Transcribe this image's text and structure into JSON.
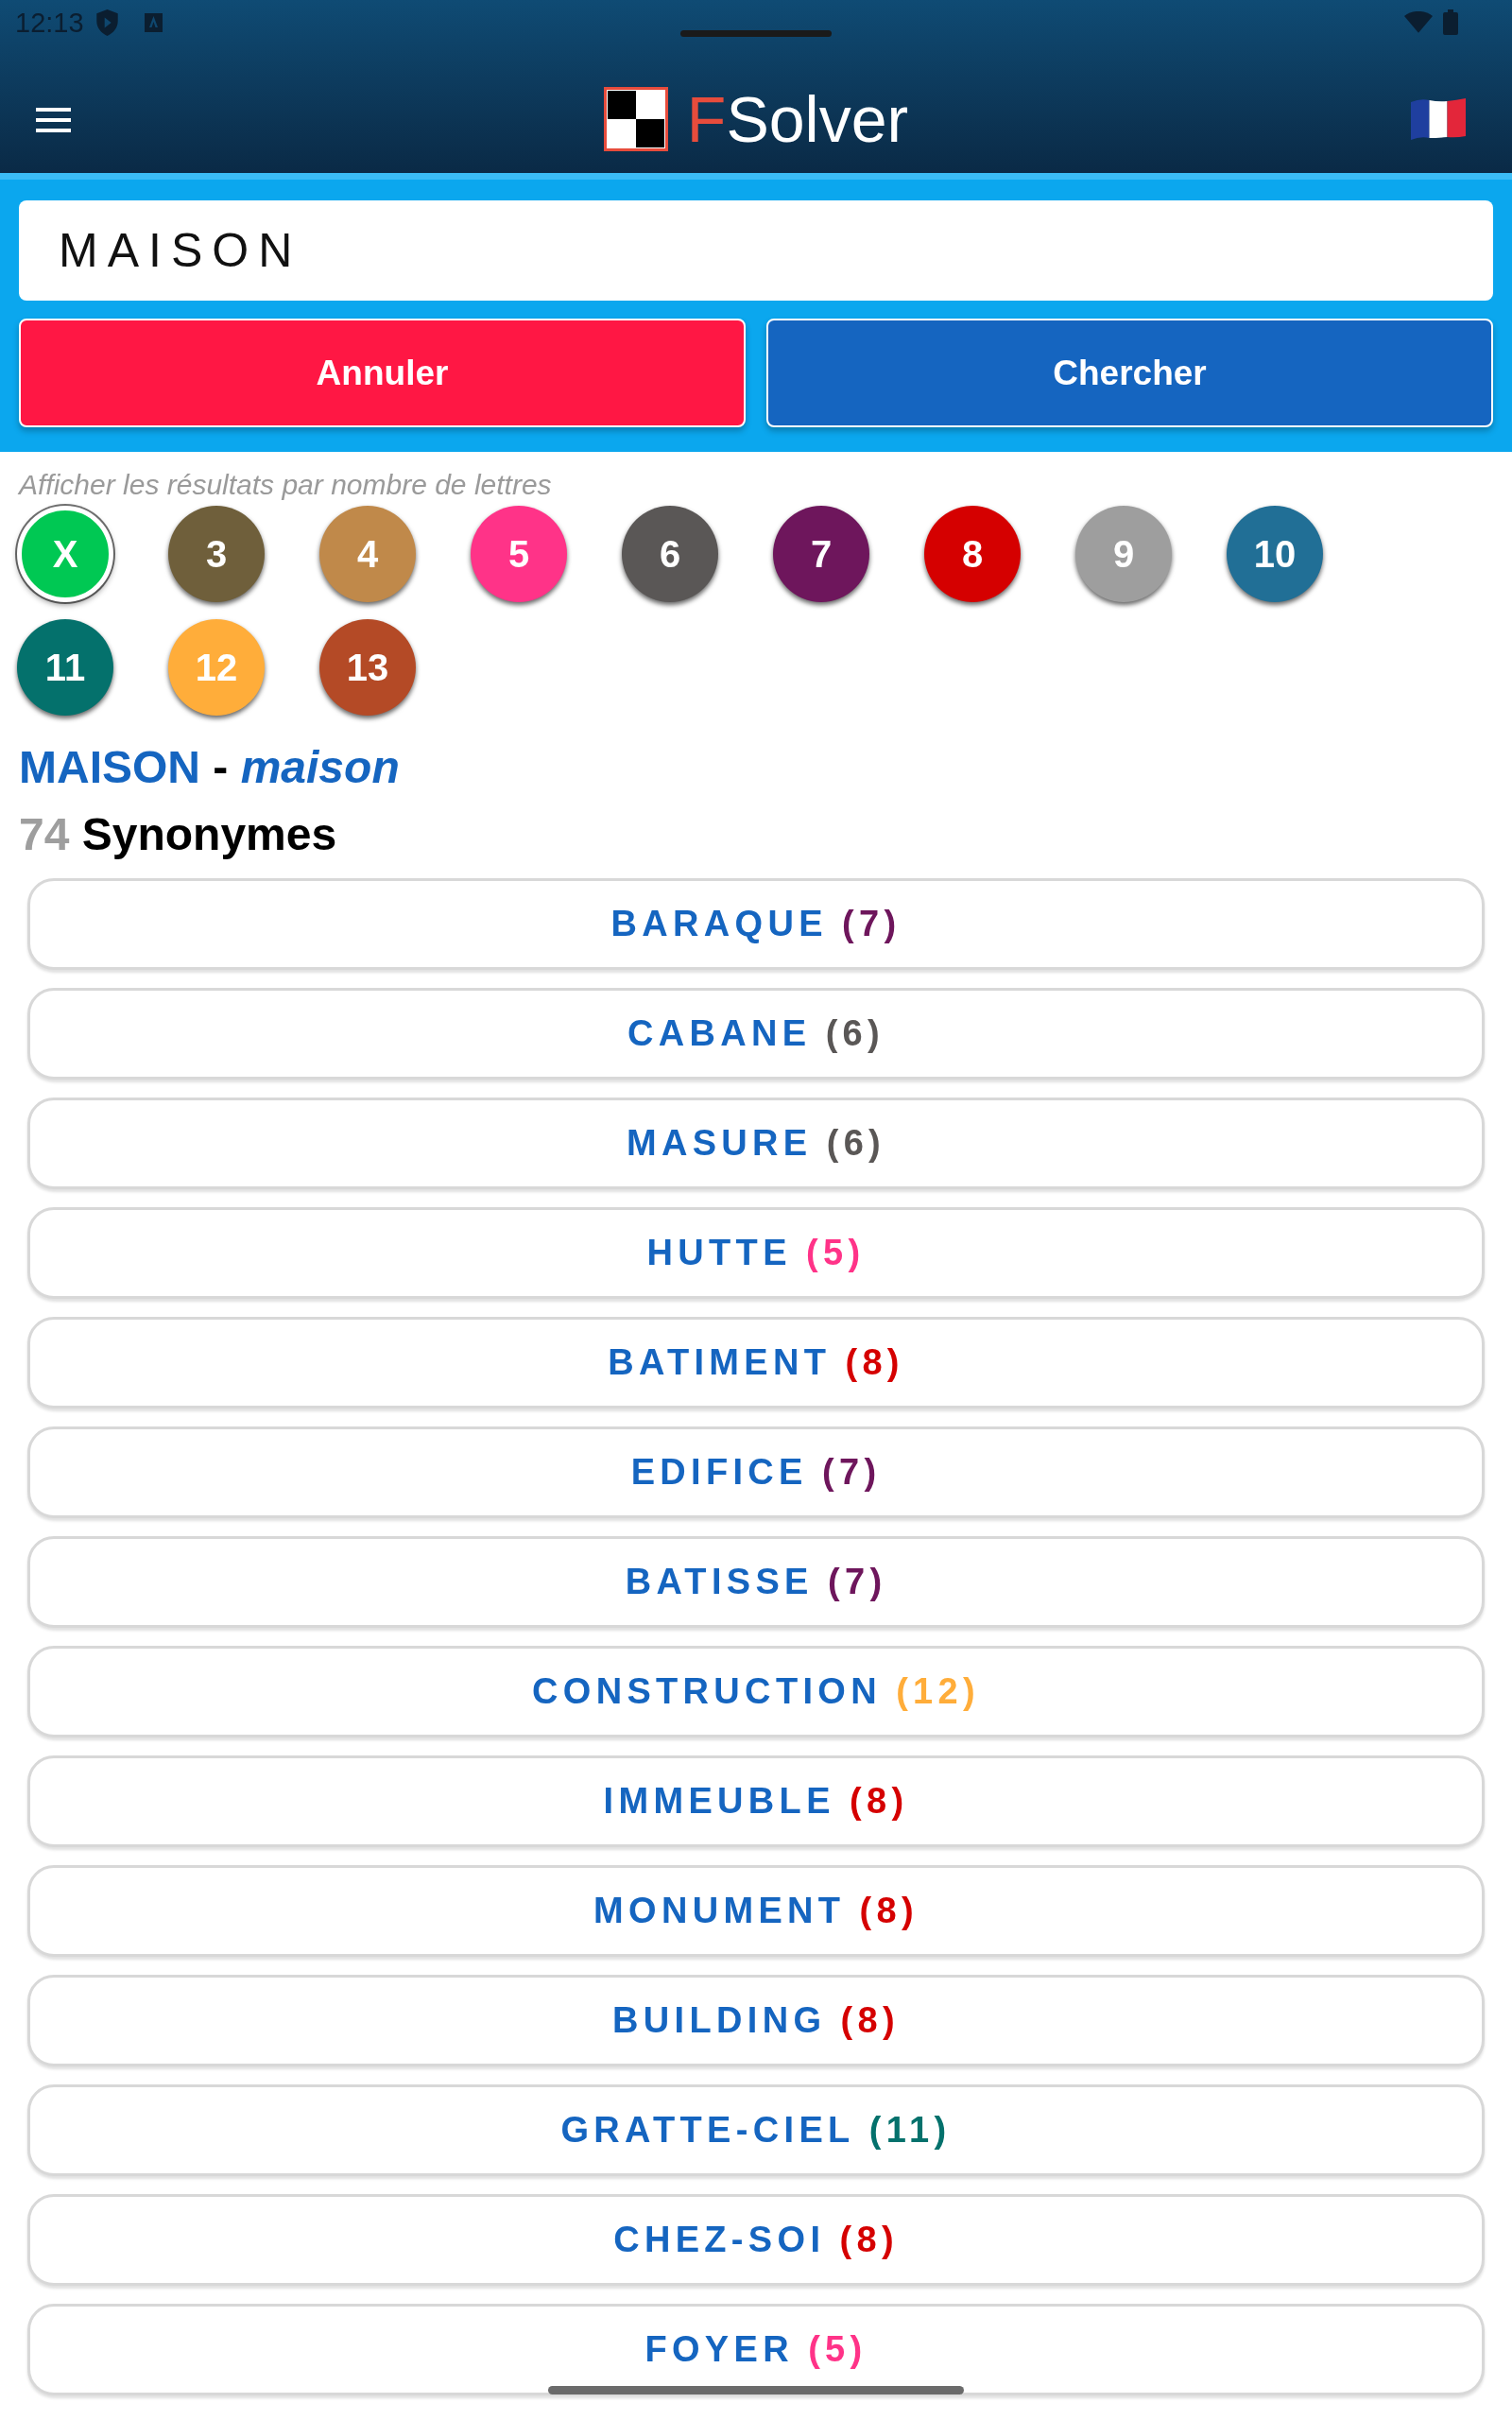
{
  "status_bar": {
    "time": "12:13"
  },
  "app_bar": {
    "title_accent": "F",
    "title": "Solver"
  },
  "search": {
    "value": "MAISON"
  },
  "buttons": [
    {
      "label": "Annuler",
      "kind": "cancel"
    },
    {
      "label": "Chercher",
      "kind": "search"
    }
  ],
  "filter": {
    "hint": "Afficher les résultats par nombre de lettres",
    "options": [
      {
        "label": "X",
        "color": "#00c853",
        "selected": true
      },
      {
        "label": "3",
        "color": "#6f5f3b",
        "selected": false
      },
      {
        "label": "4",
        "color": "#c0894a",
        "selected": false
      },
      {
        "label": "5",
        "color": "#ff3388",
        "selected": false
      },
      {
        "label": "6",
        "color": "#5a5756",
        "selected": false
      },
      {
        "label": "7",
        "color": "#6e165c",
        "selected": false
      },
      {
        "label": "8",
        "color": "#d50000",
        "selected": false
      },
      {
        "label": "9",
        "color": "#9e9e9e",
        "selected": false
      },
      {
        "label": "10",
        "color": "#216f96",
        "selected": false
      },
      {
        "label": "11",
        "color": "#04716c",
        "selected": false
      },
      {
        "label": "12",
        "color": "#ffad3a",
        "selected": false
      },
      {
        "label": "13",
        "color": "#b44a26",
        "selected": false
      }
    ]
  },
  "heading": {
    "word": "MAISON",
    "separator": "-",
    "translation": "maison"
  },
  "summary": {
    "count": "74",
    "label": "Synonymes"
  },
  "results": [
    {
      "word": "BARAQUE",
      "count": "(7)",
      "color": "#6e165c"
    },
    {
      "word": "CABANE",
      "count": "(6)",
      "color": "#5a5756"
    },
    {
      "word": "MASURE",
      "count": "(6)",
      "color": "#5a5756"
    },
    {
      "word": "HUTTE",
      "count": "(5)",
      "color": "#ff3388"
    },
    {
      "word": "BATIMENT",
      "count": "(8)",
      "color": "#d50000"
    },
    {
      "word": "EDIFICE",
      "count": "(7)",
      "color": "#6e165c"
    },
    {
      "word": "BATISSE",
      "count": "(7)",
      "color": "#6e165c"
    },
    {
      "word": "CONSTRUCTION",
      "count": "(12)",
      "color": "#ffad3a"
    },
    {
      "word": "IMMEUBLE",
      "count": "(8)",
      "color": "#d50000"
    },
    {
      "word": "MONUMENT",
      "count": "(8)",
      "color": "#d50000"
    },
    {
      "word": "BUILDING",
      "count": "(8)",
      "color": "#d50000"
    },
    {
      "word": "GRATTE-CIEL",
      "count": "(11)",
      "color": "#04716c"
    },
    {
      "word": "CHEZ-SOI",
      "count": "(8)",
      "color": "#d50000"
    },
    {
      "word": "FOYER",
      "count": "(5)",
      "color": "#ff3388"
    }
  ]
}
